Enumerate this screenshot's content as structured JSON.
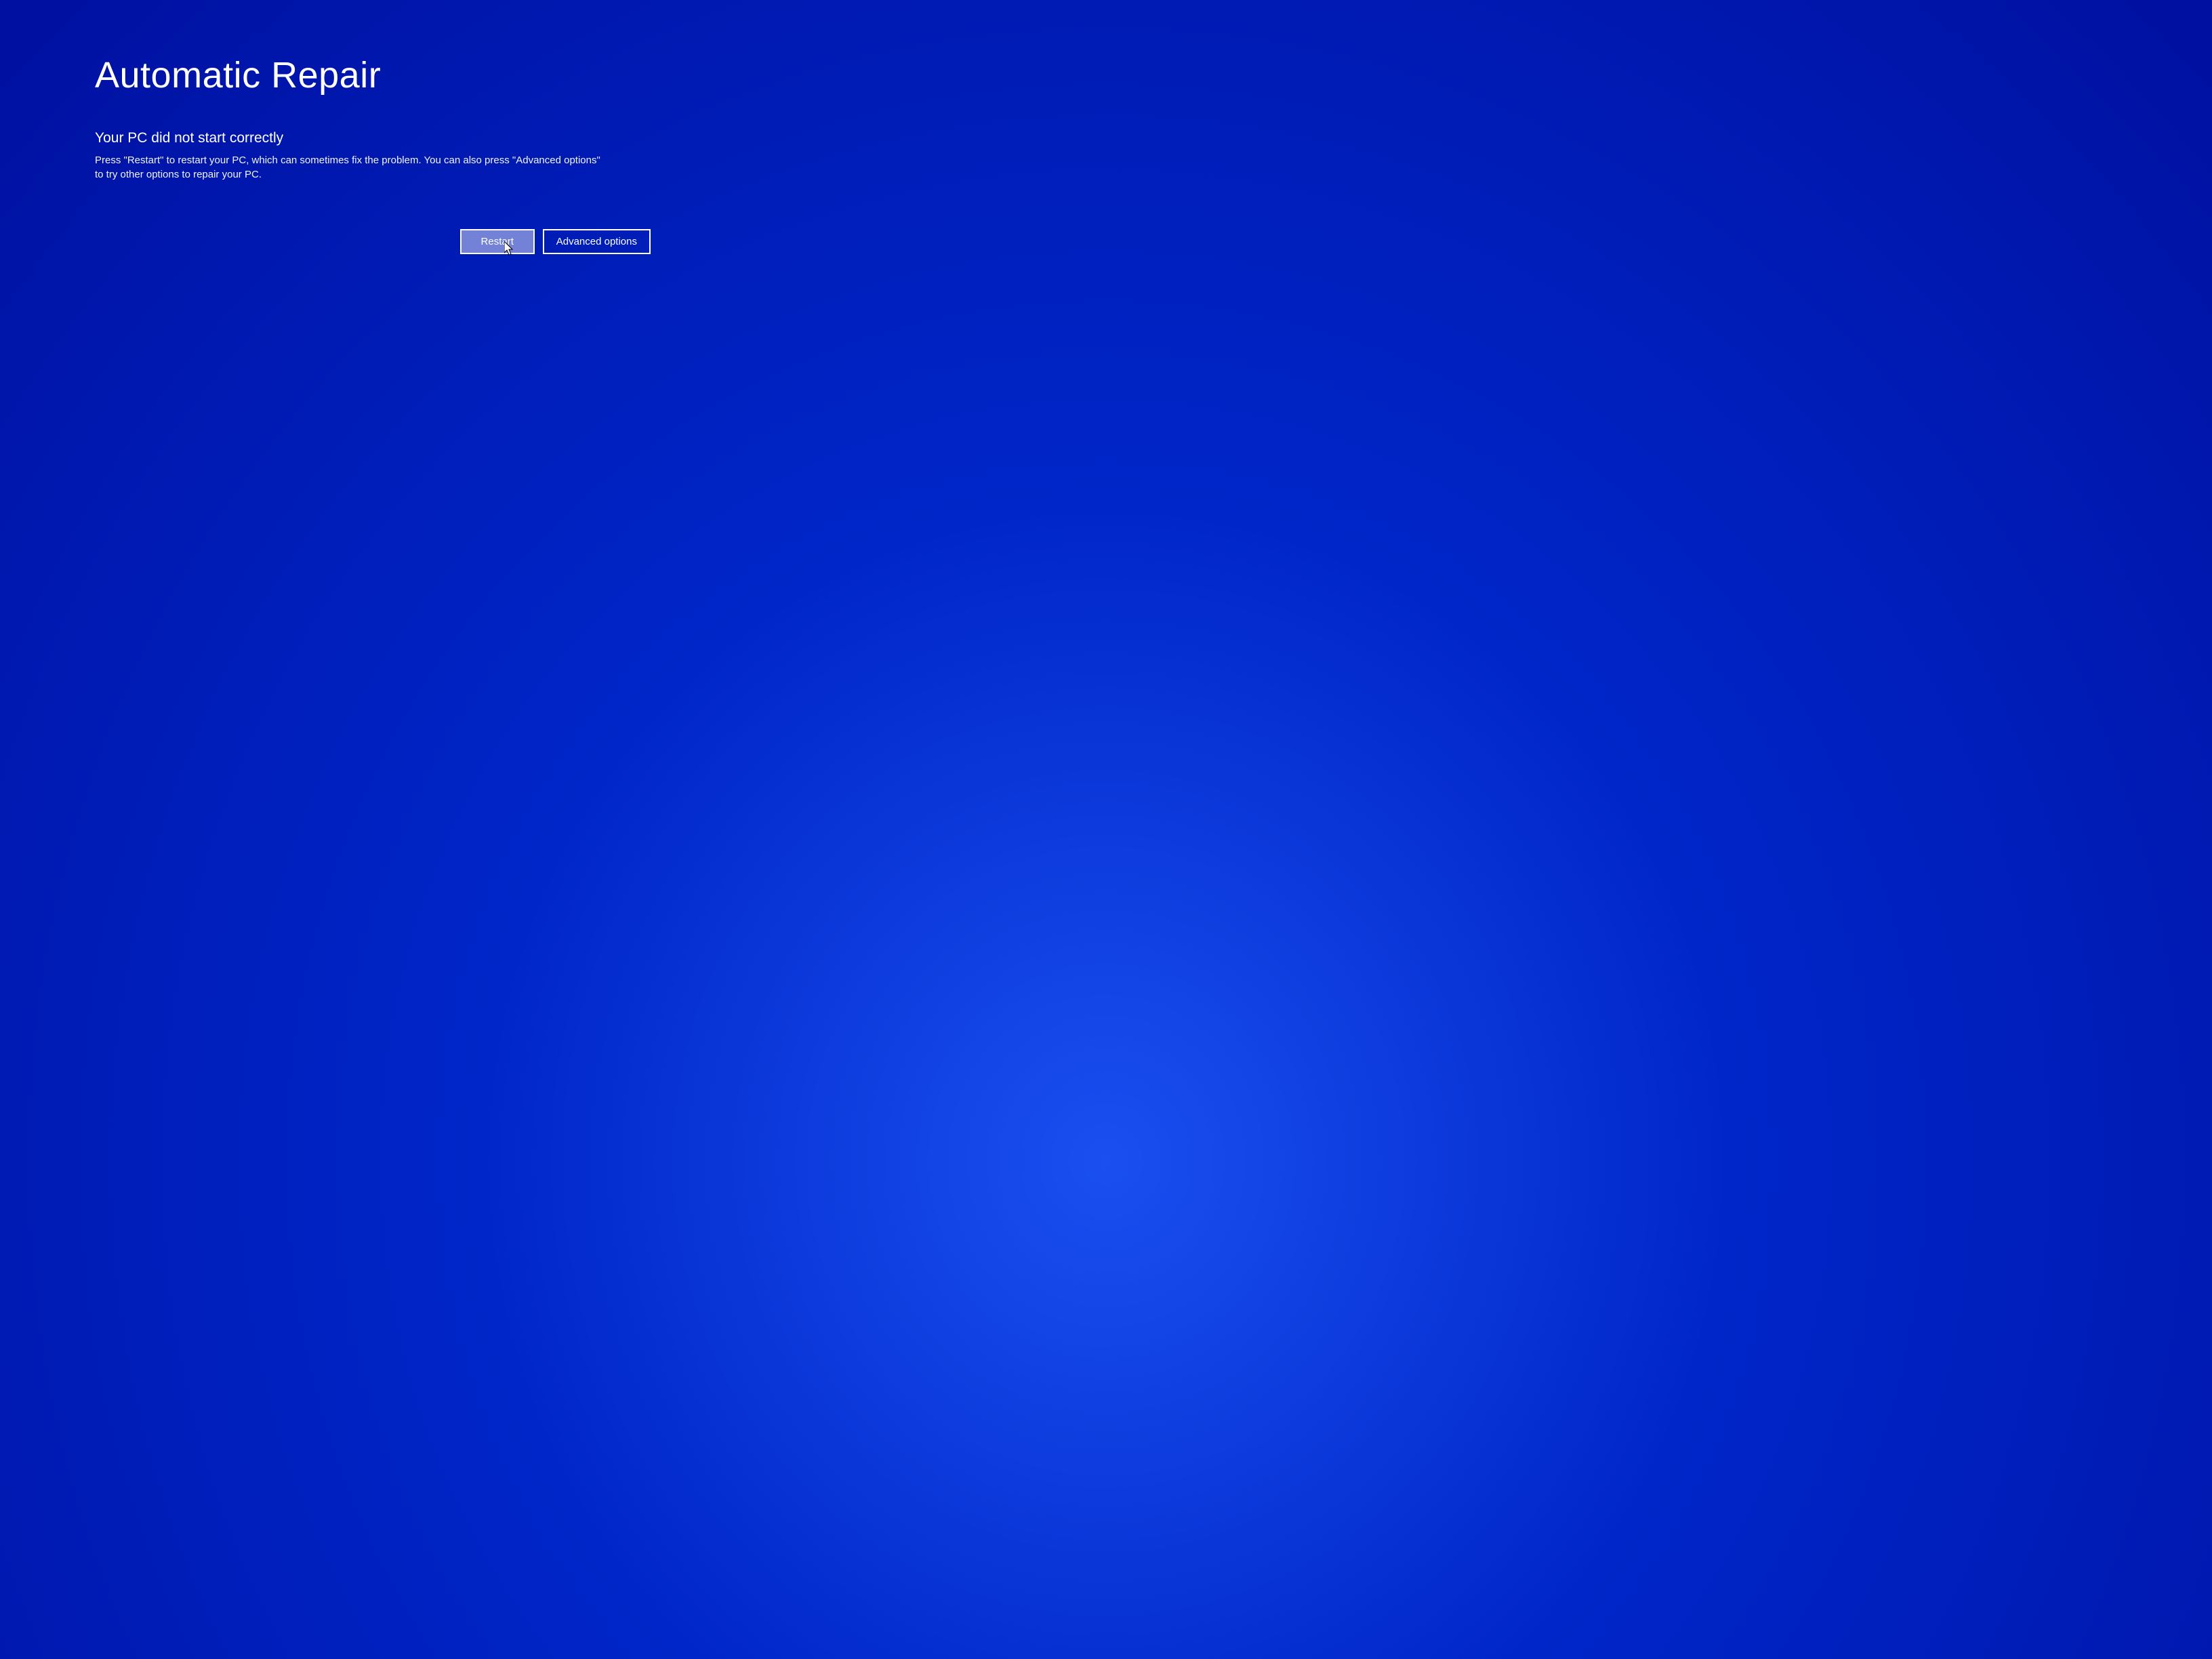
{
  "title": "Automatic Repair",
  "subtitle": "Your PC did not start correctly",
  "description": "Press \"Restart\" to restart your PC, which can sometimes fix the problem. You can also press \"Advanced options\" to try other options to repair your PC.",
  "buttons": {
    "restart": "Restart",
    "advanced": "Advanced options"
  }
}
